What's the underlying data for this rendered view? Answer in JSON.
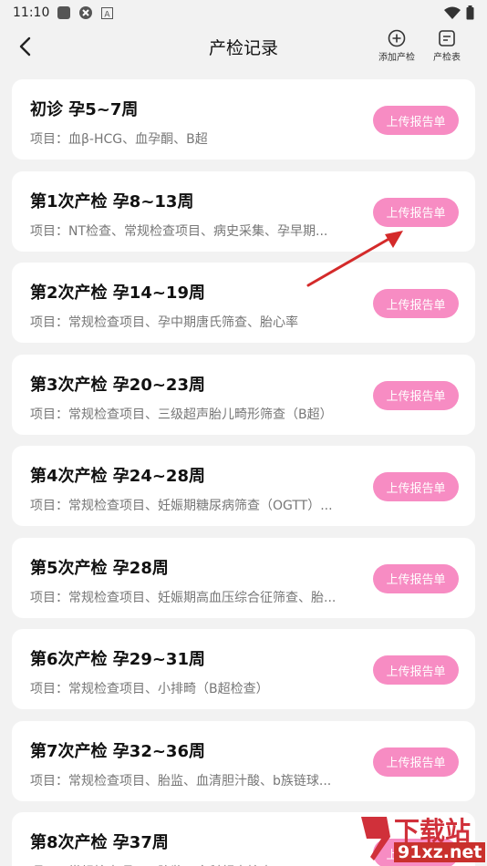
{
  "status": {
    "time": "11:10"
  },
  "header": {
    "title": "产检记录",
    "add_label": "添加产检",
    "table_label": "产检表"
  },
  "records": [
    {
      "title": "初诊 孕5~7周",
      "items": "项目：血β-HCG、血孕酮、B超",
      "button": "上传报告单"
    },
    {
      "title": "第1次产检 孕8~13周",
      "items": "项目：NT检查、常规检查项目、病史采集、孕早期...",
      "button": "上传报告单"
    },
    {
      "title": "第2次产检 孕14~19周",
      "items": "项目：常规检查项目、孕中期唐氏筛查、胎心率",
      "button": "上传报告单"
    },
    {
      "title": "第3次产检 孕20~23周",
      "items": "项目：常规检查项目、三级超声胎儿畸形筛查（B超）",
      "button": "上传报告单"
    },
    {
      "title": "第4次产检 孕24~28周",
      "items": "项目：常规检查项目、妊娠期糖尿病筛查（OGTT）...",
      "button": "上传报告单"
    },
    {
      "title": "第5次产检 孕28周",
      "items": "项目：常规检查项目、妊娠期高血压综合征筛查、胎...",
      "button": "上传报告单"
    },
    {
      "title": "第6次产检 孕29~31周",
      "items": "项目：常规检查项目、小排畸（B超检查）",
      "button": "上传报告单"
    },
    {
      "title": "第7次产检 孕32~36周",
      "items": "项目：常规检查项目、胎监、血清胆汁酸、b族链球...",
      "button": "上传报告单"
    },
    {
      "title": "第8次产检 孕37周",
      "items": "项目：常规检查项目、胎监、产科超声检查",
      "button": "上传报告单"
    }
  ],
  "watermark": {
    "brand": "下载站",
    "url": "91xz.net"
  },
  "colors": {
    "accent": "#f78cc3",
    "background": "#f2f2f2",
    "annotation_arrow": "#d42a2a"
  }
}
